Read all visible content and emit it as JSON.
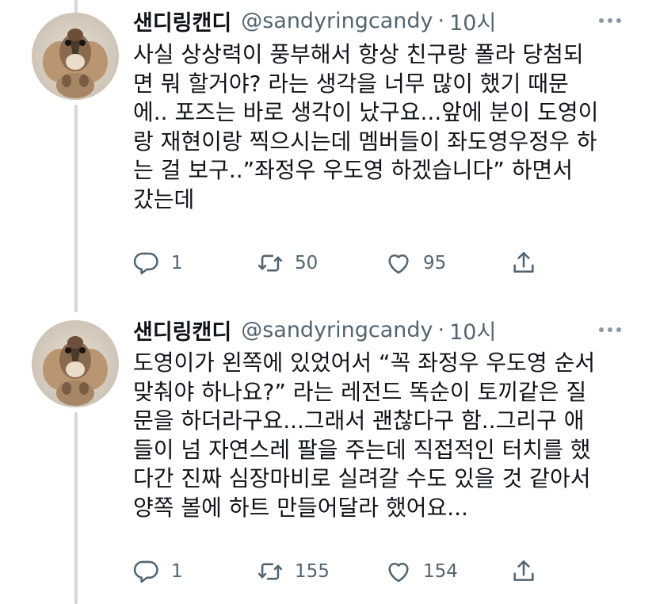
{
  "tweets": [
    {
      "name": "샌디링캔디",
      "handle": "@sandyringcandy",
      "separator": "·",
      "time": "10시",
      "lines": [
        "사실 상상력이 풍부해서 항상 친구랑 폴라 당첨되",
        "면 뭐 할거야? 라는 생각을 너무 많이 했기 때문",
        "에.. 포즈는 바로 생각이 났구요...앞에 분이 도영이",
        "랑 재현이랑 찍으시는데 멤버들이 좌도영우정우 하",
        "는 걸 보구..”좌정우 우도영 하겠습니다” 하면서",
        "갔는데"
      ],
      "replies": "1",
      "retweets": "50",
      "likes": "95"
    },
    {
      "name": "샌디링캔디",
      "handle": "@sandyringcandy",
      "separator": "·",
      "time": "10시",
      "lines": [
        "도영이가 왼쪽에 있었어서 “꼭 좌정우 우도영 순서",
        "맞춰야 하나요?” 라는 레전드 똑순이 토끼같은 질",
        "문을 하더라구요...그래서 괜찮다구 함..그리구 애",
        "들이 넘 자연스레 팔을 주는데 직접적인 터치를 했",
        "다간 진짜 심장마비로 실려갈 수도 있을 것 같아서",
        "양쪽 볼에 하트 만들어달라 했어요..."
      ],
      "replies": "1",
      "retweets": "155",
      "likes": "154"
    }
  ],
  "icons": {
    "reply": "reply-icon",
    "retweet": "retweet-icon",
    "like": "heart-icon",
    "share": "share-icon",
    "more": "more-icon",
    "avatar": "chipmunk-avatar"
  },
  "colors": {
    "text": "#0f1419",
    "secondary": "#536471",
    "thread_line": "#cfd9de"
  }
}
